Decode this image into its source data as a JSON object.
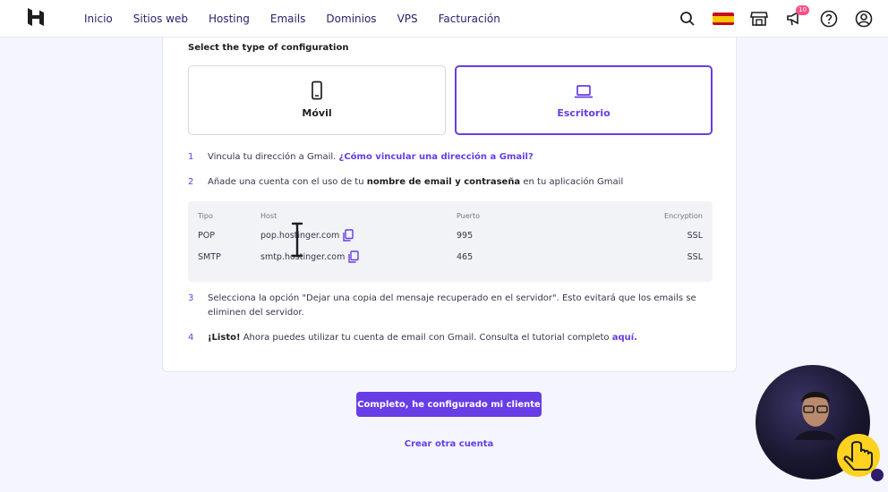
{
  "nav": {
    "links": [
      "Inicio",
      "Sitios web",
      "Hosting",
      "Emails",
      "Dominios",
      "VPS",
      "Facturación"
    ],
    "notifications_count": "10",
    "icons": [
      "search-icon",
      "spain-flag-icon",
      "store-icon",
      "megaphone-icon",
      "help-icon",
      "account-icon"
    ]
  },
  "config": {
    "title": "Select the type of configuration",
    "options": [
      {
        "label": "Móvil",
        "icon": "smartphone-icon",
        "selected": false
      },
      {
        "label": "Escritorio",
        "icon": "laptop-icon",
        "selected": true
      }
    ]
  },
  "steps": {
    "s1": {
      "num": "1",
      "text": "Vincula tu dirección a Gmail. ",
      "link": "¿Cómo vincular una dirección a Gmail?"
    },
    "s2": {
      "num": "2",
      "pre": "Añade una cuenta con el uso de tu ",
      "bold": "nombre de email y contraseña",
      "post": " en tu aplicación Gmail"
    },
    "s3": {
      "num": "3",
      "text": "Selecciona la opción \"Dejar una copia del mensaje recuperado en el servidor\". Esto evitará que los emails se eliminen del servidor."
    },
    "s4": {
      "num": "4",
      "bold": "¡Listo!",
      "text": " Ahora puedes utilizar tu cuenta de email con Gmail. Consulta el tutorial completo ",
      "link": "aquí."
    }
  },
  "table": {
    "headers": {
      "type": "Tipo",
      "host": "Host",
      "port": "Puerto",
      "encryption": "Encryption"
    },
    "rows": [
      {
        "type": "POP",
        "host": "pop.hostinger.com",
        "port": "995",
        "encryption": "SSL"
      },
      {
        "type": "SMTP",
        "host": "smtp.hostinger.com",
        "port": "465",
        "encryption": "SSL"
      }
    ]
  },
  "actions": {
    "primary": "Completo, he configurado mi cliente",
    "secondary": "Crear otra cuenta"
  },
  "colors": {
    "accent": "#673de6",
    "nav_text": "#2f1c6a",
    "background": "#f4f5ff"
  }
}
